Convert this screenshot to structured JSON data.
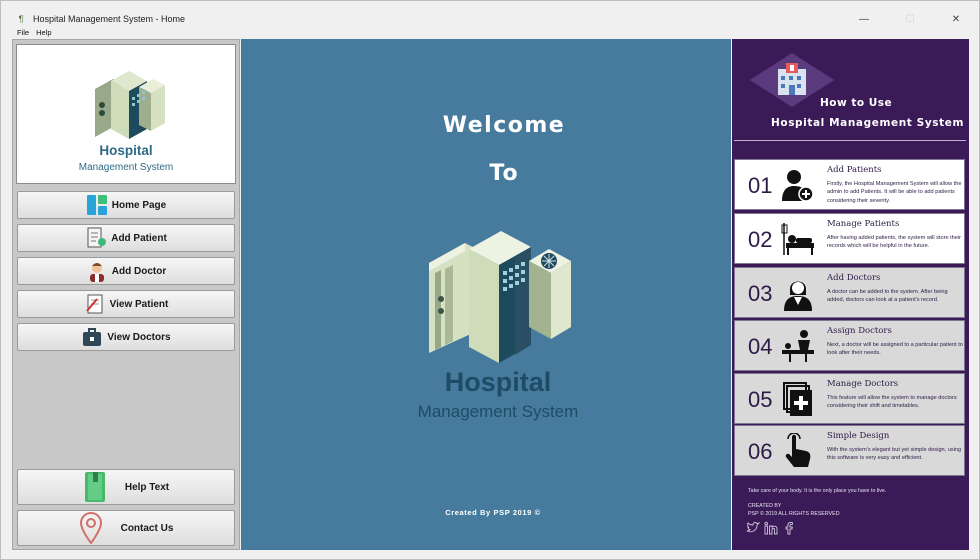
{
  "window": {
    "title": "Hospital Management System - Home",
    "minimize_symbol": "—",
    "maximize_symbol": "☐",
    "close_symbol": "✕"
  },
  "menu": [
    "File",
    "Help"
  ],
  "logo": {
    "title": "Hospital",
    "subtitle": "Management System"
  },
  "sidebar": {
    "buttons": [
      {
        "label": "Home Page",
        "icon": "home-page-icon"
      },
      {
        "label": "Add Patient",
        "icon": "add-patient-icon"
      },
      {
        "label": "Add Doctor",
        "icon": "add-doctor-icon"
      },
      {
        "label": "View Patient",
        "icon": "view-patient-icon"
      },
      {
        "label": "View Doctors",
        "icon": "view-doctors-icon"
      }
    ],
    "bottom_buttons": [
      {
        "label": "Help Text",
        "icon": "help-book-icon"
      },
      {
        "label": "Contact Us",
        "icon": "location-pin-icon"
      }
    ]
  },
  "main": {
    "welcome": "Welcome",
    "to": "To",
    "title": "Hospital",
    "subtitle": "Management System",
    "credit": "Created By PSP 2019 ©"
  },
  "howto": {
    "title": "How to Use",
    "subtitle": "Hospital Management System",
    "steps": [
      {
        "num": "01",
        "title": "Add Patients",
        "desc": "Firstly, the Hospital Management System will allow the admin to add Patients. It will be able to add patients considering their severity.",
        "icon": "add-patient-person-icon"
      },
      {
        "num": "02",
        "title": "Manage Patients",
        "desc": "After having added patients, the system will store their records which will be helpful in the future.",
        "icon": "hospital-bed-icon"
      },
      {
        "num": "03",
        "title": "Add Doctors",
        "desc": "A doctor can be added to the system. After being added, doctors can look at a patient's record.",
        "icon": "doctor-icon"
      },
      {
        "num": "04",
        "title": "Assign Doctors",
        "desc": "Next, a doctor will be assigned to a particular patient to look after their needs.",
        "icon": "doctor-patient-icon"
      },
      {
        "num": "05",
        "title": "Manage Doctors",
        "desc": "This feature will allow the system to manage doctors considering their shift and timetables.",
        "icon": "medical-files-icon"
      },
      {
        "num": "06",
        "title": "Simple Design",
        "desc": "With the system's elegant but yet simple design, using this software is very easy and efficient.",
        "icon": "tap-hand-icon"
      }
    ],
    "tagline": "Take care of your body. It is the only place you have to live.",
    "created_label": "CREATED BY",
    "rights": "PSP © 2019 ALL RIGHTS RESERVED",
    "social_icons": [
      "twitter-icon",
      "linkedin-icon",
      "facebook-icon"
    ]
  },
  "colors": {
    "center_bg": "#467b9e",
    "right_bg": "#3a1b57",
    "left_bg": "#c8c8c8",
    "accent_text": "#1f4c65"
  }
}
